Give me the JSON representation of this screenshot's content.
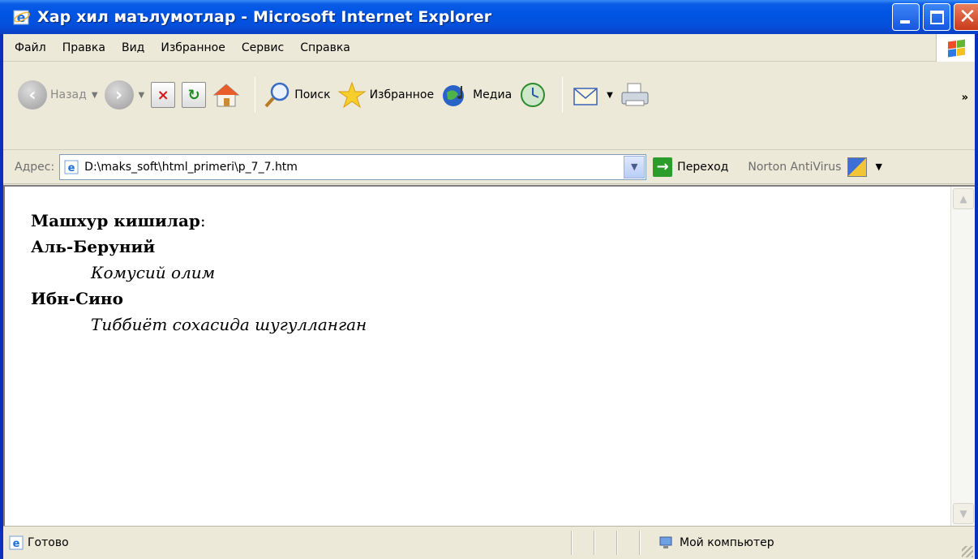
{
  "window": {
    "title": "Хар хил маълумотлар - Microsoft Internet Explorer"
  },
  "menu": {
    "items": [
      "Файл",
      "Правка",
      "Вид",
      "Избранное",
      "Сервис",
      "Справка"
    ]
  },
  "toolbar": {
    "back_label": "Назад",
    "search_label": "Поиск",
    "favorites_label": "Избранное",
    "media_label": "Медиа",
    "more_glyph": "»"
  },
  "address": {
    "label": "Адрес:",
    "value": "D:\\maks_soft\\html_primeri\\p_7_7.htm",
    "go_label": "Переход",
    "norton_label": "Norton AntiVirus"
  },
  "page": {
    "heading": "Машхур кишилар",
    "heading_suffix": ":",
    "items": [
      {
        "term": "Аль-Беруний",
        "desc": "Комусий олим"
      },
      {
        "term": "Ибн-Сино",
        "desc": "Тиббиёт сохасида шугулланган"
      }
    ]
  },
  "status": {
    "text": "Готово",
    "zone": "Мой компьютер"
  }
}
